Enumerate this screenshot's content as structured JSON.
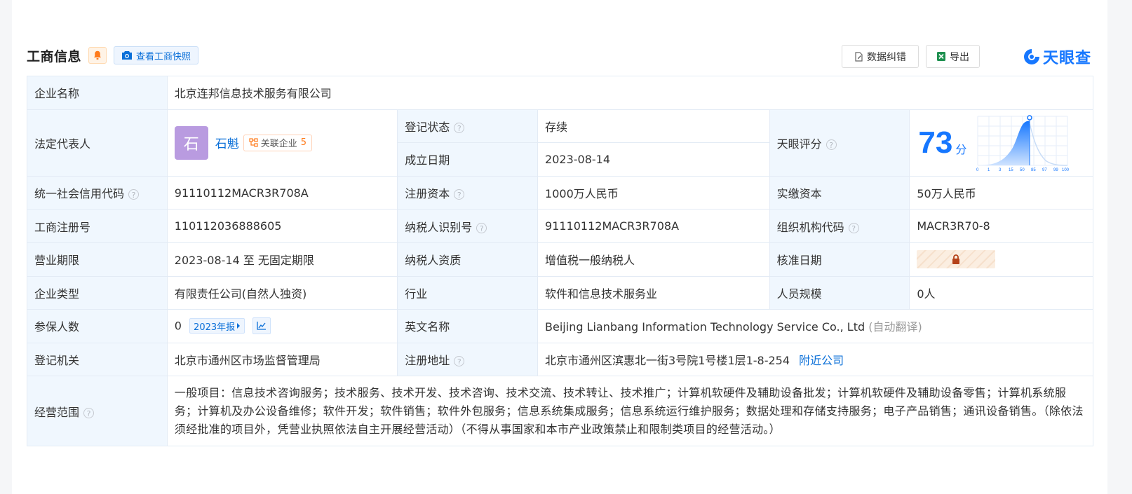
{
  "header": {
    "title": "工商信息",
    "snapshot_label": "查看工商快照",
    "correct_label": "数据纠错",
    "export_label": "导出",
    "logo_text": "天眼查"
  },
  "info": {
    "company_name_label": "企业名称",
    "company_name": "北京连邦信息技术服务有限公司",
    "legal_rep_label": "法定代表人",
    "legal_rep_avatar": "石",
    "legal_rep_name": "石魁",
    "related_label": "关联企业",
    "related_count": "5",
    "reg_status_label": "登记状态",
    "reg_status": "存续",
    "found_date_label": "成立日期",
    "found_date": "2023-08-14",
    "rating_label": "天眼评分",
    "score": "73",
    "score_unit": "分",
    "score_axis": [
      "0",
      "1",
      "3",
      "15",
      "50",
      "85",
      "97",
      "99",
      "100"
    ],
    "credit_code_label": "统一社会信用代码",
    "credit_code": "91110112MACR3R708A",
    "reg_capital_label": "注册资本",
    "reg_capital": "1000万人民币",
    "paid_capital_label": "实缴资本",
    "paid_capital": "50万人民币",
    "reg_no_label": "工商注册号",
    "reg_no": "110112036888605",
    "taxpayer_id_label": "纳税人识别号",
    "taxpayer_id": "91110112MACR3R708A",
    "org_code_label": "组织机构代码",
    "org_code": "MACR3R70-8",
    "term_label": "营业期限",
    "term": "2023-08-14 至 无固定期限",
    "taxpayer_qual_label": "纳税人资质",
    "taxpayer_qual": "增值税一般纳税人",
    "approve_date_label": "核准日期",
    "type_label": "企业类型",
    "type": "有限责任公司(自然人独资)",
    "industry_label": "行业",
    "industry": "软件和信息技术服务业",
    "staff_label": "人员规模",
    "staff": "0人",
    "insured_label": "参保人数",
    "insured": "0",
    "report_label": "2023年报",
    "en_name_label": "英文名称",
    "en_name": "Beijing Lianbang Information Technology Service Co., Ltd",
    "auto_translate": "(自动翻译)",
    "authority_label": "登记机关",
    "authority": "北京市通州区市场监督管理局",
    "address_label": "注册地址",
    "address": "北京市通州区滨惠北一街3号院1号楼1层1-8-254",
    "nearby_label": "附近公司",
    "scope_label": "经营范围",
    "scope": "一般项目：信息技术咨询服务；技术服务、技术开发、技术咨询、技术交流、技术转让、技术推广；计算机软硬件及辅助设备批发；计算机软硬件及辅助设备零售；计算机系统服务；计算机及办公设备维修；软件开发；软件销售；软件外包服务；信息系统集成服务；信息系统运行维护服务；数据处理和存储支持服务；电子产品销售；通讯设备销售。（除依法须经批准的项目外，凭营业执照依法自主开展经营活动）（不得从事国家和本市产业政策禁止和限制类项目的经营活动。）"
  },
  "colors": {
    "accent": "#0a6fd8",
    "status_green": "#00a35c",
    "label_bg": "#f0f7fe",
    "orange": "#ff7a1a"
  },
  "icons": [
    "bell-icon",
    "camera-icon",
    "document-edit-icon",
    "excel-icon",
    "tianyancha-logo-icon",
    "help-icon",
    "relation-icon",
    "chevron-right-icon",
    "trend-chart-icon",
    "lock-icon"
  ]
}
